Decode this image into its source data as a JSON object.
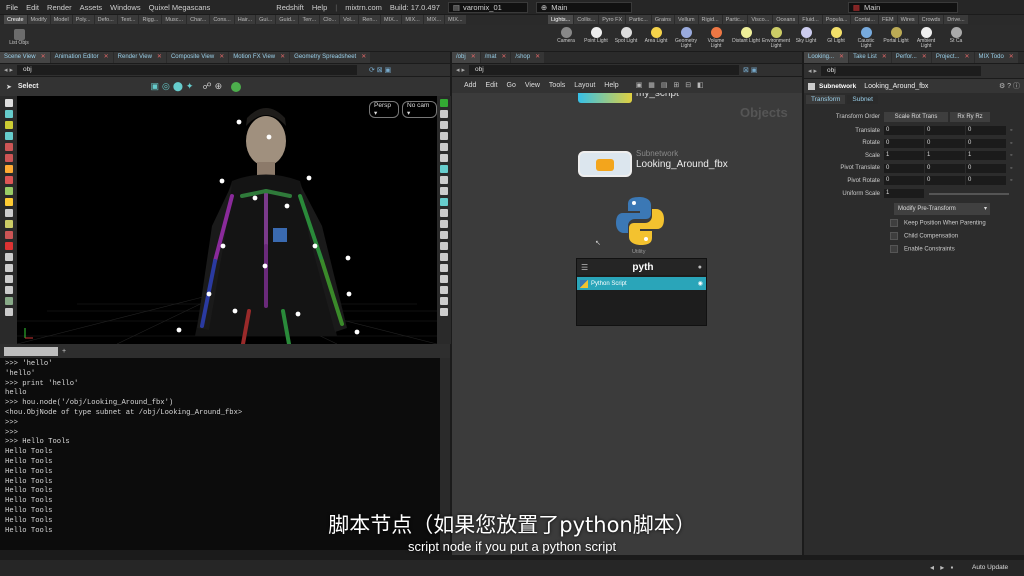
{
  "menubar": {
    "items": [
      "File",
      "Edit",
      "Render",
      "Assets",
      "Windows",
      "Quixel Megascans"
    ],
    "right_items": [
      "Redshift",
      "Help"
    ],
    "site": "mixtrn.com",
    "build": "Build: 17.0.497",
    "file_name": "varomix_01",
    "desktop": "Main",
    "desktop2": "Main"
  },
  "shelf_tabs_left": [
    "Create",
    "Modify",
    "Model",
    "Poly...",
    "Defo...",
    "Text...",
    "Rigg...",
    "Musc...",
    "Char...",
    "Cons...",
    "Hair...",
    "Gui...",
    "Guid...",
    "Terr...",
    "Clo...",
    "Vol...",
    "Ren...",
    "MIX...",
    "MIX...",
    "MIX...",
    "MIX..."
  ],
  "shelf_tabs_right": [
    "Lights...",
    "Collis...",
    "Pyro FX",
    "Partic...",
    "Grains",
    "Vellum",
    "Rigid...",
    "Partic...",
    "Visco...",
    "Oceans",
    "Fluid...",
    "Popula...",
    "Contai...",
    "FEM",
    "Wires",
    "Crowds",
    "Drive..."
  ],
  "shelf_left_tool": "List Objs",
  "light_tools": [
    "Camera",
    "Point Light",
    "Spot Light",
    "Area Light",
    "Geometry Light",
    "Volume Light",
    "Distant Light",
    "Environment Light",
    "Sky Light",
    "GI Light",
    "Caustic Light",
    "Portal Light",
    "Ambient Light",
    "St Ca"
  ],
  "viewer_tabs": [
    {
      "label": "Scene View",
      "active": true
    },
    {
      "label": "Animation Editor",
      "active": false
    },
    {
      "label": "Render View",
      "active": false
    },
    {
      "label": "Composite View",
      "active": false
    },
    {
      "label": "Motion FX View",
      "active": false
    },
    {
      "label": "Geometry Spreadsheet",
      "active": false
    }
  ],
  "viewer_path": "obj",
  "viewer_tool": "Select",
  "viewport": {
    "persp": "Persp",
    "cam": "No cam"
  },
  "console": {
    "lines": [
      ">>> 'hello'",
      "'hello'",
      ">>> print 'hello'",
      "hello",
      ">>> hou.node('/obj/Looking_Around_fbx')",
      "<hou.ObjNode of type subnet at /obj/Looking_Around_fbx>",
      ">>>",
      ">>>",
      ">>> Hello Tools",
      "Hello Tools",
      "Hello Tools",
      "Hello Tools",
      "Hello Tools",
      "Hello Tools",
      "Hello Tools",
      "Hello Tools",
      "Hello Tools",
      "Hello Tools"
    ]
  },
  "network": {
    "tabs": [
      "/obj",
      "/mat",
      "/shop"
    ],
    "path": "obj",
    "menu": [
      "Add",
      "Edit",
      "Go",
      "View",
      "Tools",
      "Layout",
      "Help"
    ],
    "context_label": "Objects",
    "node_top": "my_script",
    "subnet_type": "Subnetwork",
    "subnet_name": "Looking_Around_fbx",
    "utility_label": "Utility",
    "search_text": "pyth",
    "search_result": "Python Script"
  },
  "params": {
    "tabs": [
      "Looking...",
      "Take List",
      "Perfor...",
      "Project...",
      "MIX Todo"
    ],
    "node_type": "Subnetwork",
    "node_name": "Looking_Around_fbx",
    "subtabs": [
      "Transform",
      "Subnet"
    ],
    "transform_order_label": "Transform Order",
    "transform_order": "Scale Rot Trans",
    "rot_order": "Rx Ry Rz",
    "rows": [
      {
        "label": "Translate",
        "values": [
          "0",
          "0",
          "0"
        ]
      },
      {
        "label": "Rotate",
        "values": [
          "0",
          "0",
          "0"
        ]
      },
      {
        "label": "Scale",
        "values": [
          "1",
          "1",
          "1"
        ]
      },
      {
        "label": "Pivot Translate",
        "values": [
          "0",
          "0",
          "0"
        ]
      },
      {
        "label": "Pivot Rotate",
        "values": [
          "0",
          "0",
          "0"
        ]
      }
    ],
    "uniform_scale_label": "Uniform Scale",
    "uniform_scale": "1",
    "modify_button": "Modify Pre-Transform",
    "checks": [
      "Keep Position When Parenting",
      "Child Compensation",
      "Enable Constraints"
    ]
  },
  "subtitle_cn": "脚本节点（如果您放置了python脚本）",
  "subtitle_en": "script node if you put a python script",
  "status": {
    "auto_update": "Auto Update"
  },
  "colors": {
    "accent_blue": "#9ad0ea",
    "python_blue": "#3b78b5",
    "python_yellow": "#f3c22f",
    "selected_node": "#2aa5b9"
  }
}
